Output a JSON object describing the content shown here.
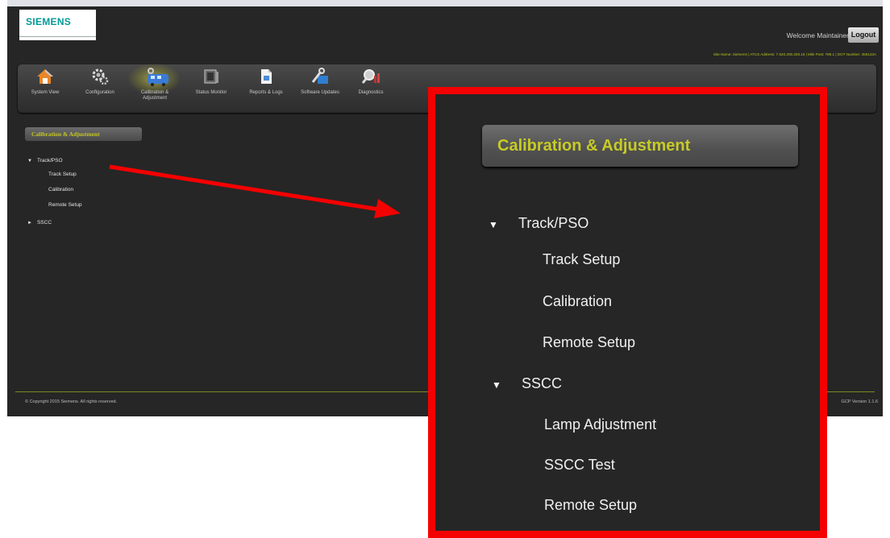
{
  "app": {
    "logo": "SIEMENS",
    "welcome": "Welcome Maintainer",
    "logout_label": "Logout",
    "site_info": "Site Name: Siemens | ATCS Address: 7.620.200.200.16 | Mile Post: 789.1 | DOT Number: 456123A",
    "toolbar": [
      {
        "label": "System View",
        "icon": "house-icon"
      },
      {
        "label": "Configuration",
        "icon": "gears-icon"
      },
      {
        "label": "Calibration & Adjustment",
        "icon": "calibration-icon"
      },
      {
        "label": "Status Monitor",
        "icon": "monitor-icon"
      },
      {
        "label": "Reports & Logs",
        "icon": "report-icon"
      },
      {
        "label": "Software Updates",
        "icon": "wrench-icon"
      },
      {
        "label": "Diagnostics",
        "icon": "magnifier-icon"
      }
    ],
    "sidebar": {
      "header": "Calibration & Adjustment",
      "groups": [
        {
          "label": "Track/PSO",
          "expanded": true,
          "items": [
            "Track Setup",
            "Calibration",
            "Remote Setup"
          ]
        },
        {
          "label": "SSCC",
          "expanded": false,
          "items": []
        }
      ]
    },
    "copyright": "© Copyright 2015 Siemens. All rights reserved.",
    "version": "GCP Version 1.1.6"
  },
  "zoom": {
    "header": "Calibration & Adjustment",
    "groups": [
      {
        "label": "Track/PSO",
        "items": [
          "Track Setup",
          "Calibration",
          "Remote Setup"
        ]
      },
      {
        "label": "SSCC",
        "items": [
          "Lamp Adjustment",
          "SSCC Test",
          "Remote Setup"
        ]
      }
    ]
  },
  "colors": {
    "accent_yellow": "#c7cb26",
    "callout_red": "#f40000",
    "background_dark": "#262626",
    "logo_teal": "#009999"
  }
}
